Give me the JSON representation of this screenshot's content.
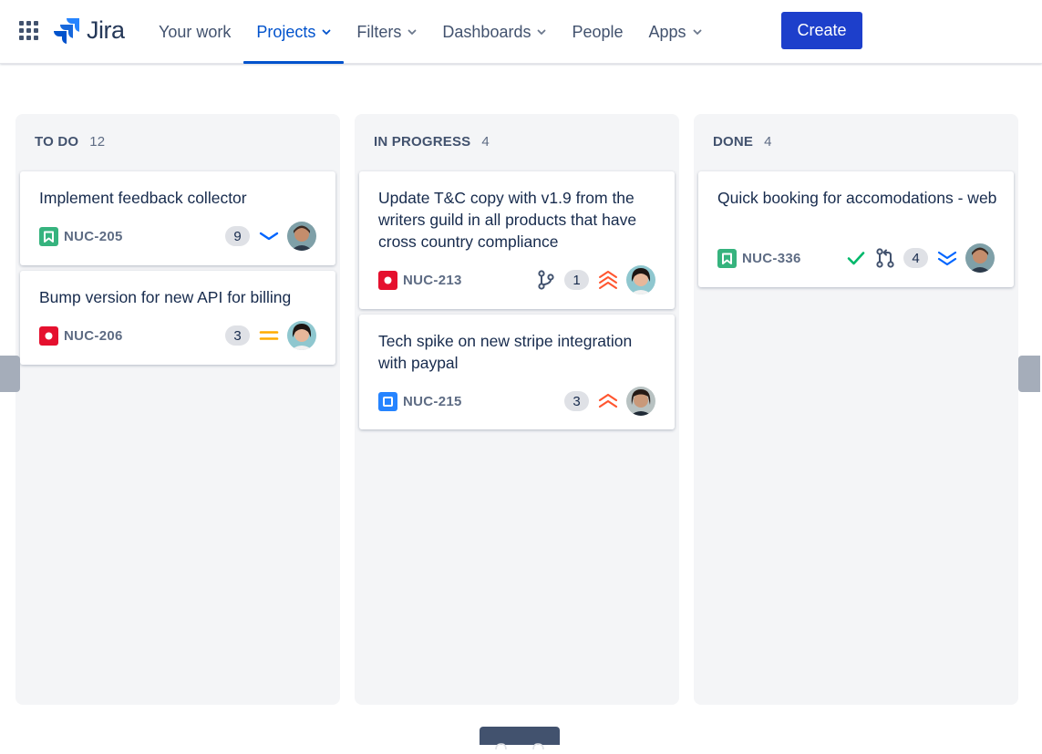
{
  "app": {
    "name": "Jira",
    "brand_color": "#0052cc"
  },
  "nav": {
    "items": [
      {
        "label": "Your work",
        "dropdown": false,
        "active": false
      },
      {
        "label": "Projects",
        "dropdown": true,
        "active": true
      },
      {
        "label": "Filters",
        "dropdown": true,
        "active": false
      },
      {
        "label": "Dashboards",
        "dropdown": true,
        "active": false
      },
      {
        "label": "People",
        "dropdown": false,
        "active": false
      },
      {
        "label": "Apps",
        "dropdown": true,
        "active": false
      }
    ],
    "create_label": "Create"
  },
  "board": {
    "columns": [
      {
        "title": "TO DO",
        "count": "12",
        "cards": [
          {
            "title": "Implement feedback collector",
            "key": "NUC-205",
            "type": "story",
            "badge": "9",
            "priority": "low"
          },
          {
            "title": "Bump version for new API for billing",
            "key": "NUC-206",
            "type": "bug",
            "badge": "3",
            "priority": "medium"
          }
        ]
      },
      {
        "title": "IN PROGRESS",
        "count": "4",
        "cards": [
          {
            "title": "Update T&C copy with v1.9 from the writers guild in all products that have cross country compliance",
            "key": "NUC-213",
            "type": "bug",
            "badge": "1",
            "priority": "highest",
            "extra_icon": "branch-icon"
          },
          {
            "title": "Tech spike on new stripe integration with paypal",
            "key": "NUC-215",
            "type": "task",
            "badge": "3",
            "priority": "high"
          }
        ]
      },
      {
        "title": "DONE",
        "count": "4",
        "cards": [
          {
            "title": "Quick booking for accomodations - web",
            "key": "NUC-336",
            "type": "story",
            "badge": "4",
            "priority": "lowest",
            "extra_icons": [
              "check-icon",
              "pull-request-icon"
            ]
          }
        ]
      }
    ]
  }
}
